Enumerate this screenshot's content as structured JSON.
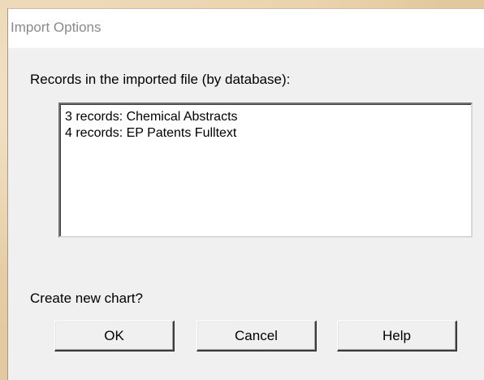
{
  "window": {
    "title": "Import Options"
  },
  "records": {
    "label": "Records in the imported file (by database):",
    "items": [
      "3 records: Chemical Abstracts",
      "4 records: EP Patents Fulltext"
    ]
  },
  "prompt": {
    "label": "Create new chart?"
  },
  "buttons": {
    "ok": "OK",
    "cancel": "Cancel",
    "help": "Help"
  }
}
